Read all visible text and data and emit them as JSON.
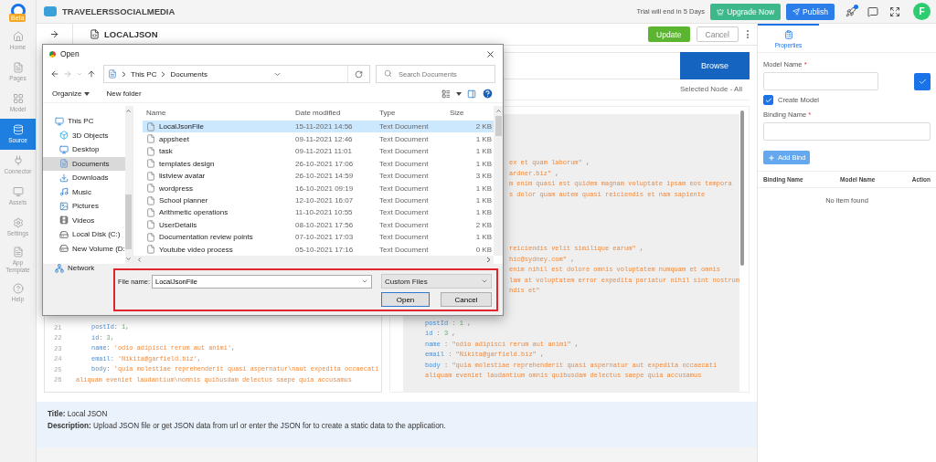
{
  "sidebar": {
    "badge": "Beta",
    "items": [
      {
        "label": "Home",
        "kind": "home",
        "selected": false
      },
      {
        "label": "Pages",
        "kind": "pages",
        "selected": false
      },
      {
        "label": "Model",
        "kind": "model",
        "selected": false
      },
      {
        "label": "Source",
        "kind": "source",
        "selected": true
      },
      {
        "label": "Connector",
        "kind": "connector",
        "selected": false
      },
      {
        "label": "Assets",
        "kind": "assets",
        "selected": false
      },
      {
        "label": "Settings",
        "kind": "settings",
        "selected": false
      },
      {
        "label": "App Template",
        "kind": "template",
        "selected": false
      },
      {
        "label": "Help",
        "kind": "help",
        "selected": false
      }
    ]
  },
  "top_bar": {
    "app_name": "TRAVELERSSOCIALMEDIA",
    "trial": "Trial will end in 5 Days",
    "upgrade": "Upgrade Now",
    "publish": "Publish",
    "notification_dot": true,
    "avatar": "F"
  },
  "header": {
    "title": "LOCALJSON",
    "update": "Update",
    "cancel": "Cancel"
  },
  "source": {
    "browse": "Browse",
    "selected_node": "Selected Node - All",
    "left_code": [
      {
        "number": "21",
        "kind": "code",
        "tokens": [
          {
            "t": "postId",
            "kind": "key"
          },
          {
            "t": ": ",
            "kind": "punct"
          },
          {
            "t": "1",
            "kind": "number"
          },
          {
            "t": ",",
            "kind": "punct"
          }
        ]
      },
      {
        "number": "22",
        "kind": "code",
        "tokens": [
          {
            "t": "id",
            "kind": "key"
          },
          {
            "t": ": ",
            "kind": "punct"
          },
          {
            "t": "3",
            "kind": "number"
          },
          {
            "t": ",",
            "kind": "punct"
          }
        ]
      },
      {
        "number": "23",
        "kind": "code",
        "tokens": [
          {
            "t": "name",
            "kind": "key"
          },
          {
            "t": ": ",
            "kind": "punct"
          },
          {
            "t": "'odio adipisci rerum aut animi'",
            "kind": "string"
          },
          {
            "t": ",",
            "kind": "punct"
          }
        ]
      },
      {
        "number": "24",
        "kind": "code",
        "tokens": [
          {
            "t": "email",
            "kind": "key"
          },
          {
            "t": ": ",
            "kind": "punct"
          },
          {
            "t": "'Nikita@garfield.biz'",
            "kind": "string"
          },
          {
            "t": ",",
            "kind": "punct"
          }
        ]
      },
      {
        "number": "25",
        "kind": "code",
        "tokens": [
          {
            "t": "body",
            "kind": "key"
          },
          {
            "t": ": ",
            "kind": "punct"
          },
          {
            "t": "'quia molestiae reprehenderit quasi aspernatur\\naut expedita occaecati",
            "kind": "string"
          }
        ]
      },
      {
        "number": "26",
        "kind": "wrap",
        "tokens": [
          {
            "t": "aliquam eveniet laudantium\\nomnis quibusdam delectus saepe quia accusamus",
            "kind": "string"
          }
        ]
      }
    ],
    "right_code": [
      {
        "kind": "clipped",
        "lines": [
          [
            {
              "t": "ex et quam laborum\"",
              "kind": "string"
            },
            {
              "t": " ,",
              "kind": "punct"
            }
          ],
          [
            {
              "t": "ardner.biz\"",
              "kind": "string"
            },
            {
              "t": " ,",
              "kind": "punct"
            }
          ],
          [
            {
              "t": "m enim quasi est quidem magnam voluptate ipsam eos tempora",
              "kind": "string"
            }
          ],
          [
            {
              "t": "s dolor quam autem quasi reiciendis et nam sapiente",
              "kind": "string"
            }
          ]
        ]
      },
      {
        "kind": "clipped",
        "lines": [
          [
            {
              "t": "reiciendis velit similique earum\"",
              "kind": "string"
            },
            {
              "t": " ,",
              "kind": "punct"
            }
          ],
          [
            {
              "t": "hic@sydney.com\"",
              "kind": "string"
            },
            {
              "t": " ,",
              "kind": "punct"
            }
          ],
          [
            {
              "t": "enim nihil est dolore omnis voluptatem numquam et omnis",
              "kind": "string"
            }
          ],
          [
            {
              "t": "lam at voluptatem error expedita pariatur nihil sint nostrum",
              "kind": "string"
            }
          ],
          [
            {
              "t": "ndis et\"",
              "kind": "string"
            }
          ]
        ]
      },
      {
        "kind": "full",
        "lines": [
          [
            {
              "t": "postId",
              "kind": "key"
            },
            {
              "t": " : ",
              "kind": "punct"
            },
            {
              "t": "1",
              "kind": "number"
            },
            {
              "t": " ,",
              "kind": "punct"
            }
          ],
          [
            {
              "t": "id",
              "kind": "key"
            },
            {
              "t": " : ",
              "kind": "punct"
            },
            {
              "t": "3",
              "kind": "number"
            },
            {
              "t": " ,",
              "kind": "punct"
            }
          ],
          [
            {
              "t": "name",
              "kind": "key"
            },
            {
              "t": " : ",
              "kind": "punct"
            },
            {
              "t": "\"odio adipisci rerum aut animi\"",
              "kind": "string"
            },
            {
              "t": " ,",
              "kind": "punct"
            }
          ],
          [
            {
              "t": "email",
              "kind": "key"
            },
            {
              "t": " : ",
              "kind": "punct"
            },
            {
              "t": "\"Nikita@garfield.biz\"",
              "kind": "string"
            },
            {
              "t": " ,",
              "kind": "punct"
            }
          ],
          [
            {
              "t": "body",
              "kind": "key"
            },
            {
              "t": " : ",
              "kind": "punct"
            },
            {
              "t": "\"quia molestiae reprehenderit quasi aspernatur aut expedita occaecati",
              "kind": "string"
            }
          ],
          [
            {
              "t": "aliquam eveniet laudantium omnis quibusdam delectus saepe quia accusamus",
              "kind": "string"
            }
          ]
        ]
      }
    ]
  },
  "info": {
    "title": "**Title:** Local JSON",
    "description": "**Description:** Upload JSON file or get JSON data from url or enter the JSON for to create a static data to the application."
  },
  "properties": {
    "tab": {
      "label": "Properties",
      "selected": true
    },
    "model_name": {
      "label": "Model Name",
      "required_mark": "*"
    },
    "create_model": {
      "label": "Create Model",
      "checked": true
    },
    "binding_name": {
      "label": "Binding Name",
      "required_mark": "*"
    },
    "add_bind": "Add Bind",
    "columns": [
      "Binding Name",
      "Model Name",
      "Action"
    ],
    "empty": "No item found"
  },
  "dialog": {
    "title": "Open",
    "path": [
      "This PC",
      "Documents"
    ],
    "search_placeholder": "Search Documents",
    "organize": "Organize",
    "new_folder": "New folder",
    "nav": [
      {
        "label": "This PC",
        "kind": "pc",
        "selected": false,
        "children": [
          {
            "label": "3D Objects",
            "kind": "cube",
            "selected": false
          },
          {
            "label": "Desktop",
            "kind": "desktop",
            "selected": false
          },
          {
            "label": "Documents",
            "kind": "documents",
            "selected": true
          },
          {
            "label": "Downloads",
            "kind": "downloads",
            "selected": false
          },
          {
            "label": "Music",
            "kind": "music",
            "selected": false
          },
          {
            "label": "Pictures",
            "kind": "pictures",
            "selected": false
          },
          {
            "label": "Videos",
            "kind": "videos",
            "selected": false
          },
          {
            "label": "Local Disk (C:)",
            "kind": "disk",
            "selected": false
          },
          {
            "label": "New Volume (D:",
            "kind": "drive",
            "selected": false
          }
        ]
      },
      {
        "label": "Network",
        "kind": "network",
        "selected": false
      }
    ],
    "columns": [
      "Name",
      "Date modified",
      "Type",
      "Size"
    ],
    "files": [
      {
        "name": "LocalJsonFile",
        "date": "15-11-2021 14:56",
        "type": "Text Document",
        "size": "2 KB",
        "selected": true
      },
      {
        "name": "appsheet",
        "date": "09-11-2021 12:46",
        "type": "Text Document",
        "size": "1 KB",
        "selected": false
      },
      {
        "name": "task",
        "date": "09-11-2021 11:01",
        "type": "Text Document",
        "size": "1 KB",
        "selected": false
      },
      {
        "name": "templates design",
        "date": "26-10-2021 17:06",
        "type": "Text Document",
        "size": "1 KB",
        "selected": false
      },
      {
        "name": "listview avatar",
        "date": "26-10-2021 14:59",
        "type": "Text Document",
        "size": "3 KB",
        "selected": false
      },
      {
        "name": "wordpress",
        "date": "16-10-2021 09:19",
        "type": "Text Document",
        "size": "1 KB",
        "selected": false
      },
      {
        "name": "School planner",
        "date": "12-10-2021 16:07",
        "type": "Text Document",
        "size": "1 KB",
        "selected": false
      },
      {
        "name": "Arithmetic operations",
        "date": "11-10-2021 10:55",
        "type": "Text Document",
        "size": "1 KB",
        "selected": false
      },
      {
        "name": "UserDetails",
        "date": "08-10-2021 17:56",
        "type": "Text Document",
        "size": "2 KB",
        "selected": false
      },
      {
        "name": "Documentation review points",
        "date": "07-10-2021 17:03",
        "type": "Text Document",
        "size": "1 KB",
        "selected": false
      },
      {
        "name": "Youtube video process",
        "date": "05-10-2021 17:16",
        "type": "Text Document",
        "size": "0 KB",
        "selected": false
      }
    ],
    "file_name_label": "File name:",
    "file_name": "LocalJsonFile",
    "file_type": "Custom Files",
    "open": "Open",
    "cancel": "Cancel"
  }
}
